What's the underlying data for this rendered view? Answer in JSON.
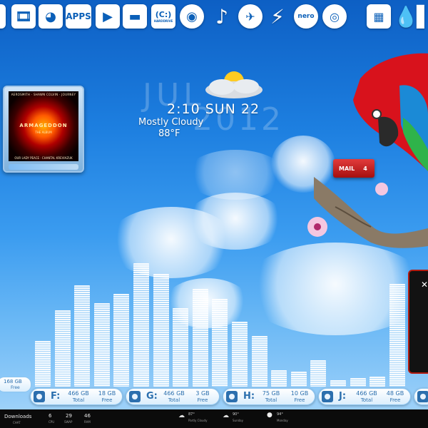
{
  "dock": {
    "apps_label": "APPS",
    "drive_label": "(C:)",
    "drive_sub": "HARDDRIVE",
    "nero_label": "nero"
  },
  "album": {
    "top_text": "AEROSMITH · SHAWN COLVIN · JOURNEY",
    "title": "ARMAGEDDON",
    "subtitle": "THE ALBUM",
    "bottom_text": "OUR LADY PEACE · CHANTAL KREVIAZUK"
  },
  "clock": {
    "month": "JUL",
    "year": "2012",
    "time": "2:10 SUN 22",
    "condition": "Mostly Cloudy",
    "temperature": "88°F"
  },
  "mail": {
    "label": "MAIL",
    "count": "4"
  },
  "equalizer": {
    "levels": [
      0.36,
      0.6,
      0.8,
      0.66,
      0.73,
      0.97,
      0.89,
      0.62,
      0.77,
      0.69,
      0.51,
      0.4,
      0.13,
      0.12,
      0.21,
      0.05,
      0.07,
      0.08,
      0.81
    ]
  },
  "drives": {
    "partial": {
      "value": "168 GB",
      "label": "Free"
    },
    "items": [
      {
        "letter": "F:",
        "total": "466 GB",
        "total_label": "Total",
        "free": "18 GB",
        "free_label": "Free"
      },
      {
        "letter": "G:",
        "total": "466 GB",
        "total_label": "Total",
        "free": "3 GB",
        "free_label": "Free"
      },
      {
        "letter": "H:",
        "total": "75 GB",
        "total_label": "Total",
        "free": "10 GB",
        "free_label": "Free"
      },
      {
        "letter": "J:",
        "total": "466 GB",
        "total_label": "Total",
        "free": "48 GB",
        "free_label": "Free"
      }
    ]
  },
  "taskbar": {
    "downloads": "Downloads",
    "chat": "CHAT",
    "cpu_value": "6",
    "cpu_label": "CPU",
    "swap_value": "29",
    "swap_label": "SWAP",
    "ram_value": "46",
    "ram_label": "RAM",
    "weather": [
      {
        "temp": "87°",
        "label": "Partly Cloudy"
      },
      {
        "temp": "90°",
        "label": "Sunday"
      },
      {
        "temp": "94°",
        "label": "Monday"
      }
    ]
  }
}
